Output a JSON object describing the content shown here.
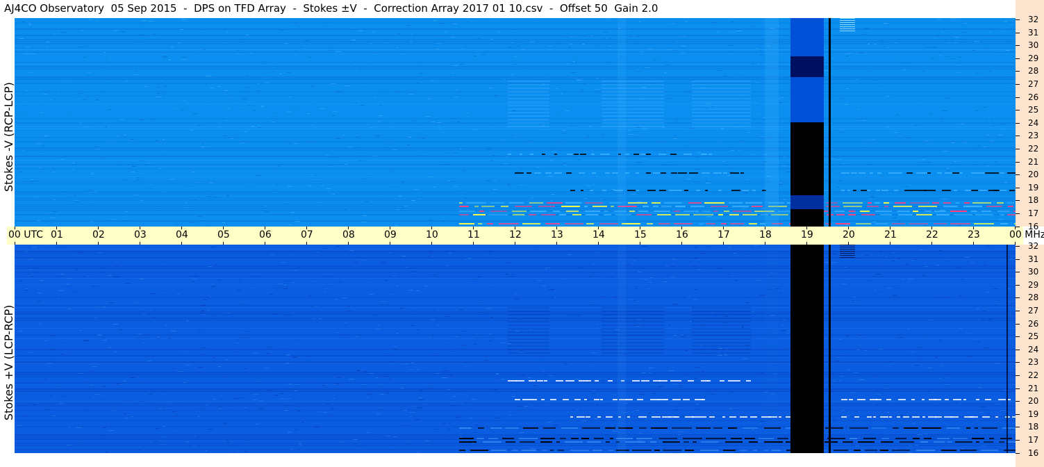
{
  "title": "AJ4CO Observatory  05 Sep 2015  -  DPS on TFD Array  -  Stokes ±V  -  Correction Array 2017 01 10.csv  -  Offset 50  Gain 2.0",
  "panels": {
    "top": {
      "ylabel": "Stokes -V (RCP-LCP)"
    },
    "bottom": {
      "ylabel": "Stokes +V (LCP-RCP)"
    }
  },
  "time_axis": {
    "labels": [
      "00 UTC",
      "01",
      "02",
      "03",
      "04",
      "05",
      "06",
      "07",
      "08",
      "09",
      "10",
      "11",
      "12",
      "13",
      "14",
      "15",
      "16",
      "17",
      "18",
      "19",
      "20",
      "21",
      "22",
      "23",
      "00 MHz"
    ]
  },
  "freq_axis": {
    "labels": [
      "32",
      "31",
      "30",
      "29",
      "28",
      "27",
      "26",
      "25",
      "24",
      "23",
      "22",
      "21",
      "20",
      "19",
      "18",
      "17",
      "16"
    ]
  },
  "colors": {
    "top_bg": "#0a8ef0",
    "bottom_bg": "#0a5ce0",
    "axis_bg": "#ffffc8",
    "scale_bg": "#fde4cf"
  }
}
